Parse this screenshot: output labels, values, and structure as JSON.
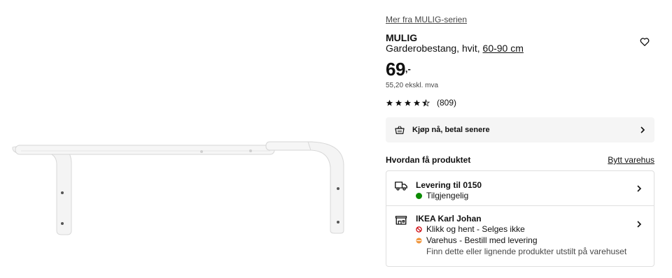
{
  "series_link": "Mer fra MULIG-serien",
  "product": {
    "name": "MULIG",
    "description": "Garderobestang, hvit, ",
    "size": "60-90 cm",
    "price_int": "69",
    "price_dec": ",-",
    "price_ex_vat": "55,20 ekskl. mva",
    "rating": 4.5,
    "rating_count": "(809)"
  },
  "buy_banner": {
    "label": "Kjøp nå, betal senere"
  },
  "delivery": {
    "title": "Hvordan få produktet",
    "change_store": "Bytt varehus",
    "home": {
      "title": "Levering til 0150",
      "status": "Tilgjengelig",
      "status_color": "#0a8a00"
    },
    "store": {
      "title": "IKEA Karl Johan",
      "click_collect": "Klikk og hent - Selges ikke",
      "click_collect_color": "#cc0008",
      "warehouse": "Varehus - Bestill med levering",
      "warehouse_color": "#f0963c",
      "note": "Finn dette eller lignende produkter utstilt på varehuset"
    }
  }
}
